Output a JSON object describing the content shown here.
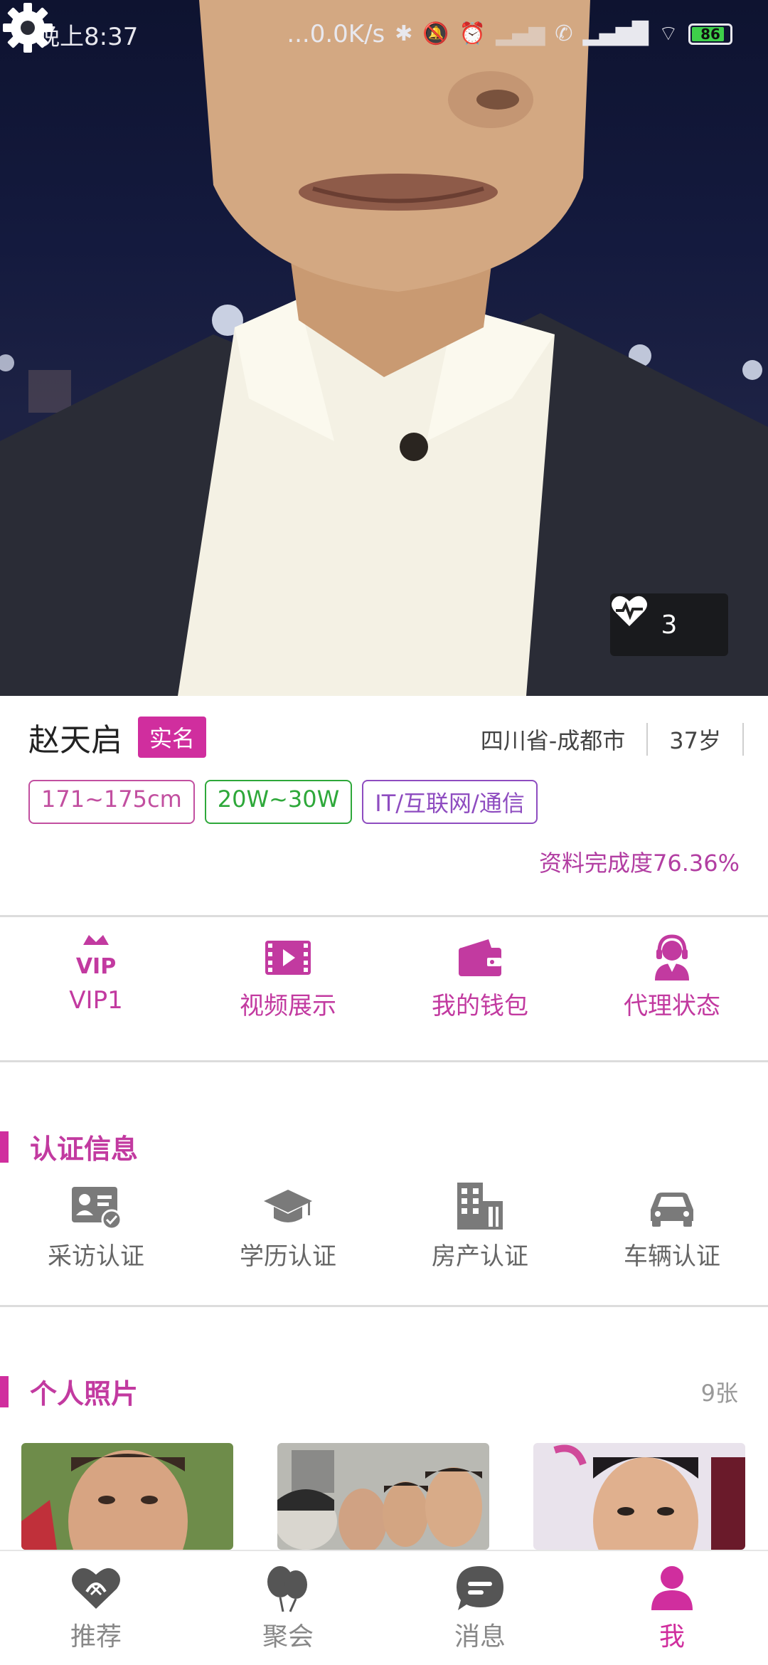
{
  "status_bar": {
    "time": "晚上8:37",
    "net_speed": "...0.0K/s",
    "battery": "86",
    "icons": [
      "bluetooth-icon",
      "mute-bell-icon",
      "alarm-icon",
      "signal-icon",
      "no-call-icon",
      "signal-bars-icon",
      "wifi-icon",
      "battery-icon"
    ]
  },
  "hero": {
    "likes_count": "3",
    "like_icon": "heartbeat-icon",
    "settings_icon": "gear-icon"
  },
  "profile": {
    "name": "赵天启",
    "real_name_badge": "实名",
    "location": "四川省-成都市",
    "age": "37岁",
    "tags": {
      "height": "171~175cm",
      "income": "20W~30W",
      "industry": "IT/互联网/通信"
    },
    "completeness": "资料完成度76.36%"
  },
  "actions": [
    {
      "label": "VIP1",
      "icon": "vip-crown-icon"
    },
    {
      "label": "视频展示",
      "icon": "video-film-icon"
    },
    {
      "label": "我的钱包",
      "icon": "wallet-icon"
    },
    {
      "label": "代理状态",
      "icon": "agent-headset-icon"
    }
  ],
  "certification": {
    "title": "认证信息",
    "items": [
      {
        "label": "采访认证",
        "icon": "id-card-check-icon"
      },
      {
        "label": "学历认证",
        "icon": "graduation-cap-icon"
      },
      {
        "label": "房产认证",
        "icon": "building-icon"
      },
      {
        "label": "车辆认证",
        "icon": "car-icon"
      }
    ]
  },
  "photos": {
    "title": "个人照片",
    "count": "9张"
  },
  "bottom_nav": [
    {
      "label": "推荐",
      "icon": "heart-recommend-icon",
      "active": false
    },
    {
      "label": "聚会",
      "icon": "balloons-icon",
      "active": false
    },
    {
      "label": "消息",
      "icon": "chat-bubble-icon",
      "active": false
    },
    {
      "label": "我",
      "icon": "person-icon",
      "active": true
    }
  ],
  "colors": {
    "accent": "#d02e9e",
    "accent_text": "#c23aa0",
    "income_tag": "#2ea83a",
    "industry_tag": "#8e4cc0",
    "inactive": "#888888"
  }
}
